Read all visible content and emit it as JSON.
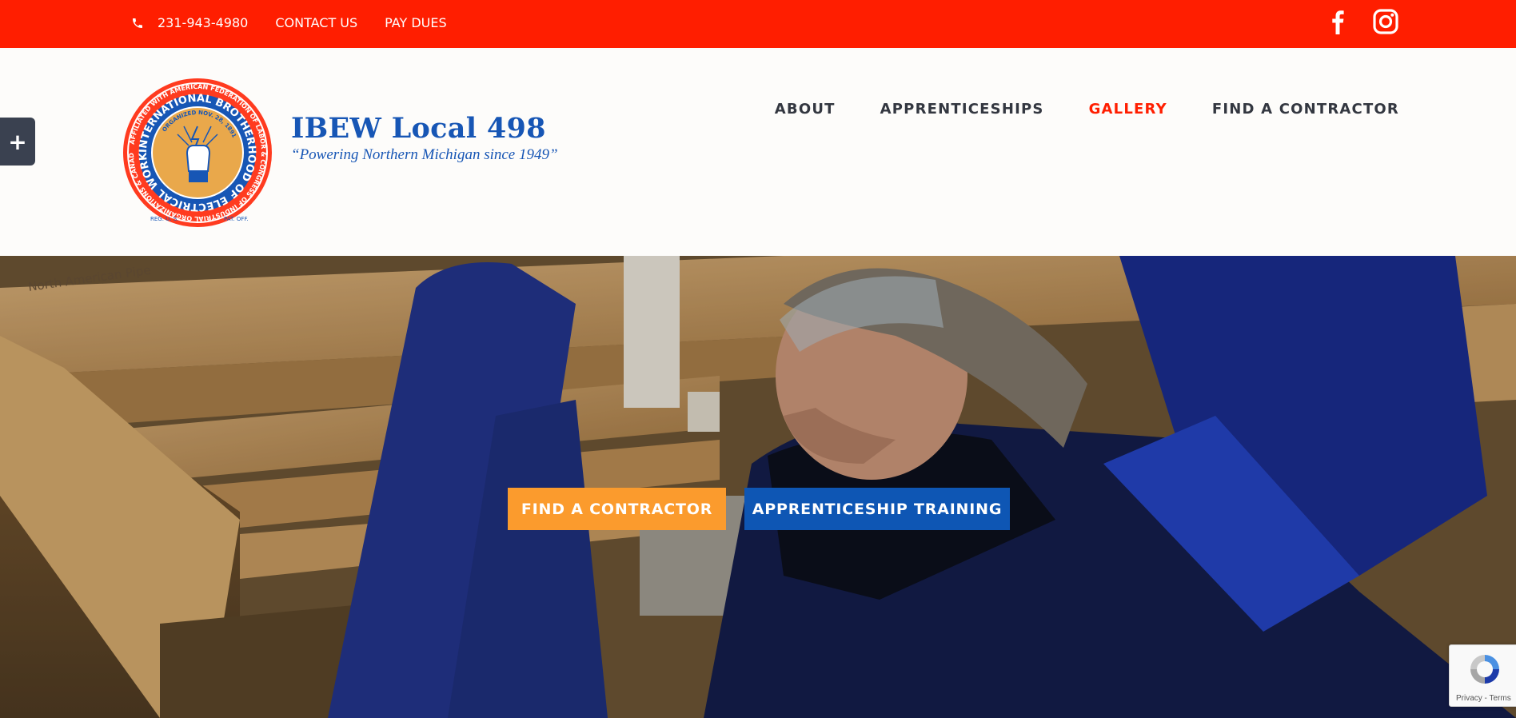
{
  "topbar": {
    "phone": "231-943-4980",
    "contact": "CONTACT US",
    "pay_dues": "PAY DUES",
    "social": [
      "facebook-icon",
      "instagram-icon"
    ],
    "background": "#ff1e00"
  },
  "brand": {
    "title": "IBEW Local 498",
    "tagline": "“Powering Northern Michigan since 1949”",
    "color": "#1756b5"
  },
  "logo": {
    "outer_text": "INTERNATIONAL BROTHERHOOD OF ELECTRICAL WORKERS",
    "inner_top": "ORGANIZED NOV. 28, 1891",
    "ring_text": "AFFILIATED WITH AMERICAN FEDERATION OF LABOR & CONGRESS OF INDUSTRIAL ORGANIZATIONS & CANADIAN LABOUR CONGRESS",
    "bottom_left": "REG. U. S.",
    "bottom_right": "PAT. OFF."
  },
  "nav": {
    "items": [
      {
        "label": "ABOUT",
        "active": false
      },
      {
        "label": "APPRENTICESHIPS",
        "active": false
      },
      {
        "label": "GALLERY",
        "active": true
      },
      {
        "label": "FIND A CONTRACTOR",
        "active": false
      }
    ]
  },
  "side_toggle": "+",
  "hero": {
    "buttons": {
      "contractor": "FIND A CONTRACTOR",
      "apprenticeship": "APPRENTICESHIP TRAINING"
    },
    "pipe_text": "North American Pipe",
    "colors": {
      "orange": "#fb9b2d",
      "blue": "#0e56b4"
    }
  },
  "recaptcha": {
    "text": "Privacy - Terms"
  }
}
